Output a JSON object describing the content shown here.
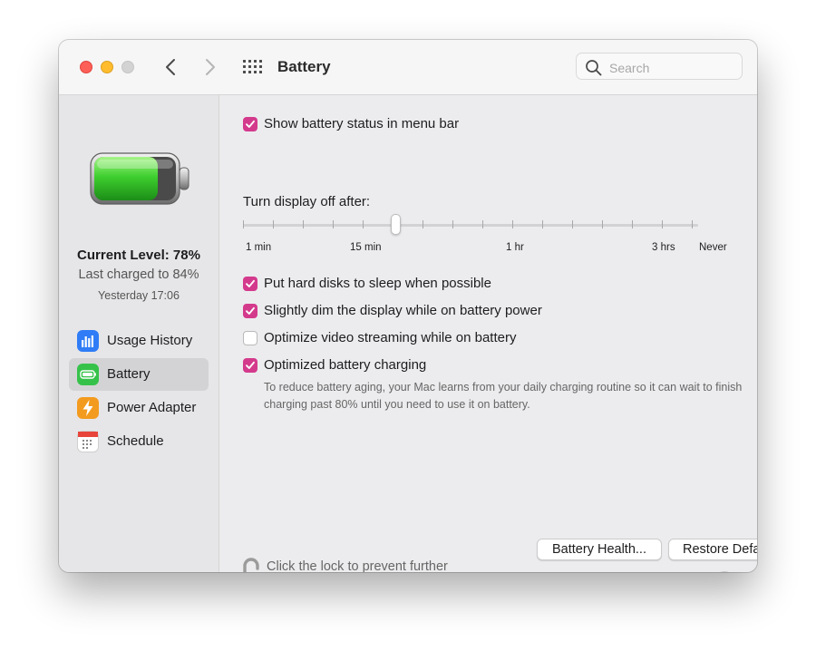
{
  "titlebar": {
    "title": "Battery",
    "search_placeholder": "Search"
  },
  "sidebar": {
    "current_level": "Current Level: 78%",
    "battery_level_fraction": 0.78,
    "last_charged": "Last charged to 84%",
    "last_charged_time": "Yesterday 17:06",
    "items": [
      {
        "label": "Usage History",
        "icon": "bar-chart-icon",
        "color": "#2f7cf6"
      },
      {
        "label": "Battery",
        "icon": "battery-icon",
        "color": "#36c24a",
        "active": true
      },
      {
        "label": "Power Adapter",
        "icon": "lightning-icon",
        "color": "#f39b1f"
      },
      {
        "label": "Schedule",
        "icon": "calendar-icon",
        "color": "#ffffff"
      }
    ]
  },
  "settings": {
    "show_status": {
      "label": "Show battery status in menu bar",
      "checked": true
    },
    "display_off_label": "Turn display off after:",
    "slider": {
      "labels": [
        "1 min",
        "15 min",
        "1 hr",
        "3 hrs",
        "Never"
      ],
      "value": "15 min"
    },
    "options": [
      {
        "label": "Put hard disks to sleep when possible",
        "checked": true
      },
      {
        "label": "Slightly dim the display while on battery power",
        "checked": true
      },
      {
        "label": "Optimize video streaming while on battery",
        "checked": false
      },
      {
        "label": "Optimized battery charging",
        "checked": true
      }
    ],
    "optimized_desc": "To reduce battery aging, your Mac learns from your daily charging routine so it can wait to finish charging past 80% until you need to use it on battery."
  },
  "footer": {
    "battery_health_label": "Battery Health...",
    "restore_defaults_label": "Restore Defaults",
    "lock_text": "Click the lock to prevent further changes.",
    "help_label": "?"
  },
  "colors": {
    "checkbox_accent": "#d43a8c",
    "battery_green": "#3fcf2f"
  }
}
